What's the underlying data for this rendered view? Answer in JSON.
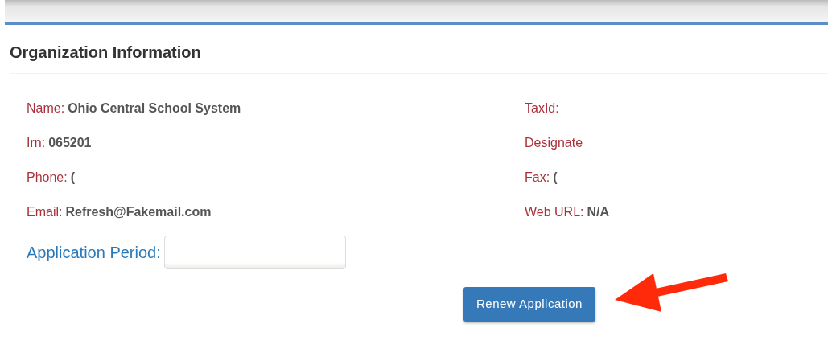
{
  "section": {
    "title": "Organization Information"
  },
  "left_fields": [
    {
      "label": "Name:",
      "value": "Ohio Central School System"
    },
    {
      "label": "Irn:",
      "value": "065201"
    },
    {
      "label": "Phone:",
      "value": "("
    },
    {
      "label": "Email:",
      "value": "Refresh@Fakemail.com"
    }
  ],
  "right_fields": [
    {
      "label": "TaxId:"
    },
    {
      "label": "Designate"
    },
    {
      "label": "Fax:",
      "value": "("
    },
    {
      "label": "Web URL:",
      "value": "N/A"
    }
  ],
  "application_period": {
    "label": "Application Period:"
  },
  "buttons": [
    {
      "label": "Renew Application",
      "kind": "primary"
    }
  ],
  "annotation": {
    "kind": "arrow"
  }
}
